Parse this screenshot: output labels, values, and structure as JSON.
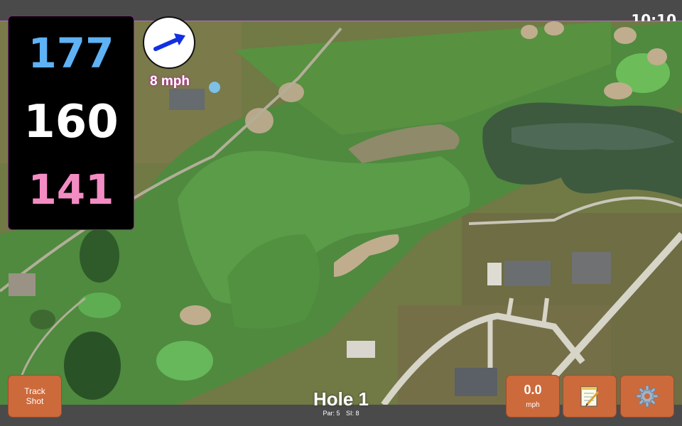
{
  "status": {
    "time": "10:10"
  },
  "yardage": {
    "back": "177",
    "middle": "160",
    "front": "141"
  },
  "wind": {
    "speed": "8 mph",
    "direction_icon": "wind-arrow-icon"
  },
  "buttons": {
    "track_shot": [
      "Track",
      "Shot"
    ],
    "speed_value": "0.0",
    "speed_unit": "mph",
    "notes_icon": "notepad-icon",
    "settings_icon": "gear-icon"
  },
  "hole": {
    "title": "Hole 1",
    "par": "Par: 5",
    "si": "SI: 8"
  },
  "colors": {
    "back_yardage": "#5fb2f5",
    "middle_yardage": "#ffffff",
    "front_yardage": "#f48cc4",
    "button_bg": "#cc6a3c",
    "wind_text_glow": "#b0308f"
  }
}
